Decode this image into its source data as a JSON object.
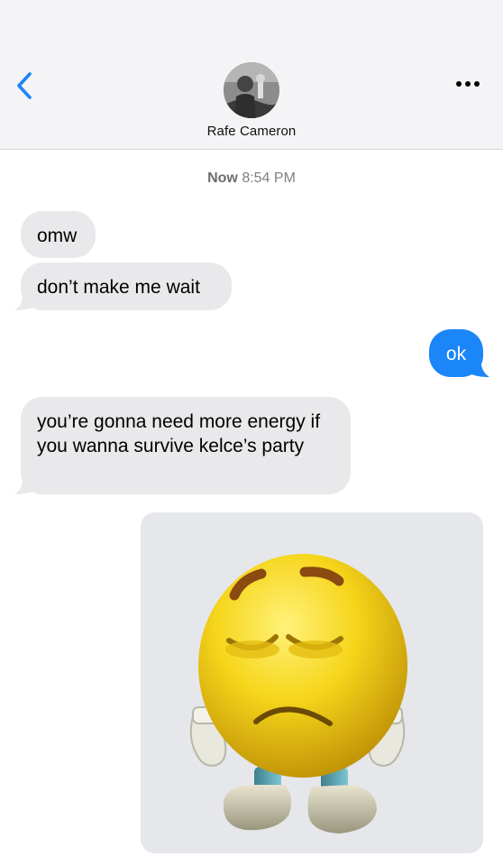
{
  "header": {
    "contact_name": "Rafe Cameron",
    "back_icon": "chevron-left-icon",
    "more_icon": "ellipsis-icon"
  },
  "thread": {
    "timestamp_day": "Now",
    "timestamp_time": "8:54 PM",
    "messages": [
      {
        "direction": "incoming",
        "text": "omw"
      },
      {
        "direction": "incoming",
        "text": "don’t make me wait"
      },
      {
        "direction": "outgoing",
        "text": "ok"
      },
      {
        "direction": "incoming",
        "text": "you’re gonna need more energy if you wanna survive kelce’s party"
      },
      {
        "direction": "incoming",
        "type": "sticker",
        "sticker": "sad-emoji-sticker"
      }
    ]
  },
  "colors": {
    "accent": "#1b86f7",
    "incoming_bubble": "#e9e9eb",
    "header_bg": "#f4f4f6"
  }
}
